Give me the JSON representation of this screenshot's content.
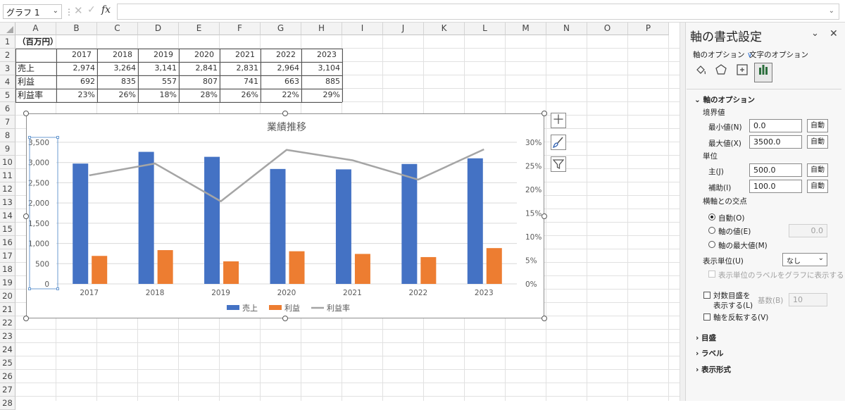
{
  "formula_bar": {
    "name_box": "グラフ 1",
    "fx": "fx",
    "cancel": "✕",
    "enter": "✓",
    "formula": ""
  },
  "columns": [
    "A",
    "B",
    "C",
    "D",
    "E",
    "F",
    "G",
    "H",
    "I",
    "J",
    "K",
    "L",
    "M",
    "N",
    "O",
    "P"
  ],
  "rows": [
    "1",
    "2",
    "3",
    "4",
    "5",
    "6",
    "7",
    "8",
    "9",
    "10",
    "11",
    "12",
    "13",
    "14",
    "15",
    "16",
    "17",
    "18",
    "19",
    "20",
    "21",
    "22",
    "23",
    "24",
    "25",
    "26",
    "27",
    "28"
  ],
  "sheet": {
    "unit_label": "（百万円）",
    "years": [
      "2017",
      "2018",
      "2019",
      "2020",
      "2021",
      "2022",
      "2023"
    ],
    "rows": [
      {
        "label": "売上",
        "values": [
          "2,974",
          "3,264",
          "3,141",
          "2,841",
          "2,831",
          "2,964",
          "3,104"
        ]
      },
      {
        "label": "利益",
        "values": [
          "692",
          "835",
          "557",
          "807",
          "741",
          "663",
          "885"
        ]
      },
      {
        "label": "利益率",
        "values": [
          "23%",
          "26%",
          "18%",
          "28%",
          "26%",
          "22%",
          "29%"
        ]
      }
    ]
  },
  "chart_data": {
    "type": "bar",
    "title": "業績推移",
    "categories": [
      "2017",
      "2018",
      "2019",
      "2020",
      "2021",
      "2022",
      "2023"
    ],
    "series": [
      {
        "name": "売上",
        "type": "bar",
        "axis": "left",
        "color": "#4472C4",
        "values": [
          2974,
          3264,
          3141,
          2841,
          2831,
          2964,
          3104
        ]
      },
      {
        "name": "利益",
        "type": "bar",
        "axis": "left",
        "color": "#ED7D31",
        "values": [
          692,
          835,
          557,
          807,
          741,
          663,
          885
        ]
      },
      {
        "name": "利益率",
        "type": "line",
        "axis": "right",
        "color": "#A5A5A5",
        "values": [
          0.23,
          0.255,
          0.175,
          0.284,
          0.262,
          0.221,
          0.285
        ]
      }
    ],
    "ylim": [
      0,
      3500
    ],
    "y_ticks": [
      "0",
      "500",
      "1,000",
      "1,500",
      "2,000",
      "2,500",
      "3,000",
      "3,500"
    ],
    "y2lim": [
      0,
      0.3
    ],
    "y2_ticks": [
      "0%",
      "5%",
      "10%",
      "15%",
      "20%",
      "25%",
      "30%"
    ],
    "grid": true,
    "legend": "bottom"
  },
  "pane": {
    "title": "軸の書式設定",
    "tab_axis_options": "軸のオプション",
    "tab_text_options": "文字のオプション",
    "section_axis_options": "軸のオプション",
    "bounds_label": "境界値",
    "min_label": "最小値(N)",
    "min_value": "0.0",
    "max_label": "最大値(X)",
    "max_value": "3500.0",
    "auto": "自動",
    "units_label": "単位",
    "major_label": "主(J)",
    "major_value": "500.0",
    "minor_label": "補助(I)",
    "minor_value": "100.0",
    "crosses_label": "横軸との交点",
    "crosses_auto": "自動(O)",
    "crosses_value": "軸の値(E)",
    "crosses_value_input": "0.0",
    "crosses_max": "軸の最大値(M)",
    "display_units_label": "表示単位(U)",
    "display_units_value": "なし",
    "show_units_label": "表示単位のラベルをグラフに表示する",
    "log_scale_label_1": "対数目盛を",
    "log_scale_label_2": "表示する(L)",
    "base_label": "基数(B)",
    "base_value": "10",
    "reverse_label": "軸を反転する(V)",
    "section_ticks": "目盛",
    "section_labels": "ラベル",
    "section_number": "表示形式"
  }
}
